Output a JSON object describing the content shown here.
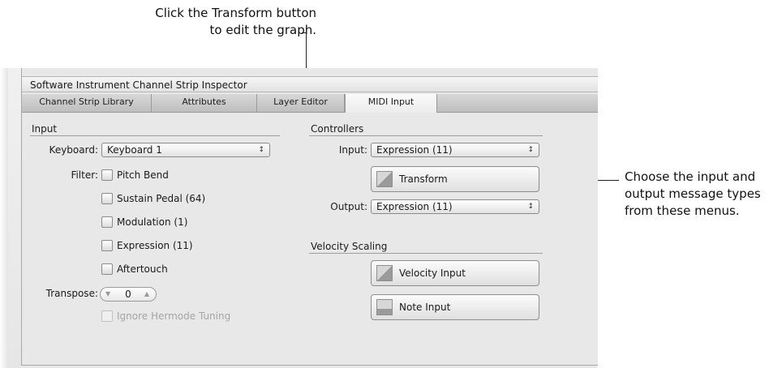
{
  "callouts": {
    "top_line1": "Click the Transform button",
    "top_line2": "to edit the graph.",
    "right_line1": "Choose the input and",
    "right_line2": "output message types",
    "right_line3": "from these menus."
  },
  "window": {
    "title": "Software Instrument Channel Strip Inspector",
    "tabs": [
      "Channel Strip Library",
      "Attributes",
      "Layer Editor",
      "MIDI Input"
    ],
    "active_tab": "MIDI Input"
  },
  "input_section": {
    "title": "Input",
    "keyboard_label": "Keyboard:",
    "keyboard_value": "Keyboard 1",
    "filter_label": "Filter:",
    "filters": [
      {
        "label": "Pitch Bend",
        "checked": false
      },
      {
        "label": "Sustain Pedal (64)",
        "checked": false
      },
      {
        "label": "Modulation (1)",
        "checked": false
      },
      {
        "label": "Expression (11)",
        "checked": false
      },
      {
        "label": "Aftertouch",
        "checked": false
      }
    ],
    "transpose_label": "Transpose:",
    "transpose_value": "0",
    "ignore_hermode": "Ignore Hermode Tuning"
  },
  "controllers_section": {
    "title": "Controllers",
    "input_label": "Input:",
    "input_value": "Expression (11)",
    "transform_button": "Transform",
    "output_label": "Output:",
    "output_value": "Expression (11)"
  },
  "velocity_section": {
    "title": "Velocity Scaling",
    "velocity_input_button": "Velocity Input",
    "note_input_button": "Note Input"
  },
  "icons": {
    "popup_arrows": "↕",
    "stepper_down": "▼",
    "stepper_up": "▲"
  }
}
